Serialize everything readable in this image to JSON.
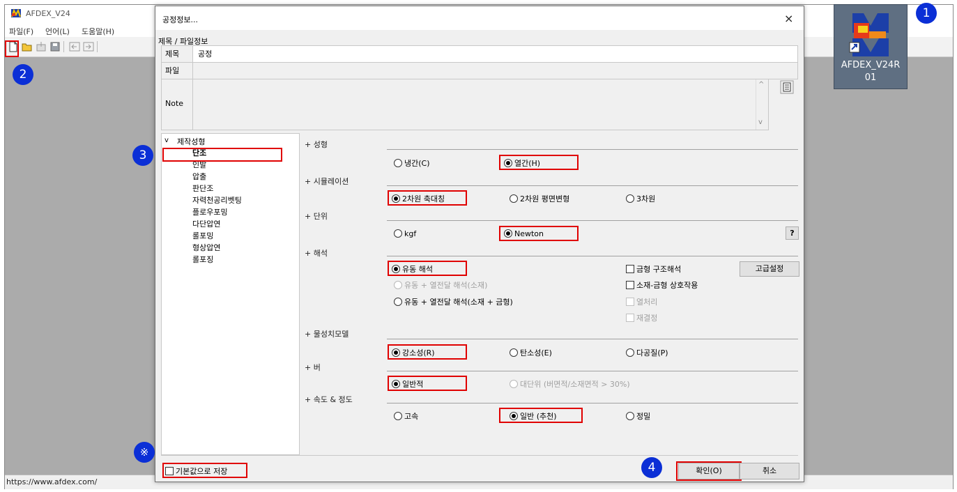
{
  "app": {
    "title": "AFDEX_V24",
    "menu": [
      "파일(F)",
      "언어(L)",
      "도움말(H)"
    ],
    "status_url": "https://www.afdex.com/"
  },
  "shortcut": {
    "label_line1": "AFDEX_V24R",
    "label_line2": "01"
  },
  "dialog": {
    "title": "공정정보...",
    "close": "×",
    "group_title": "제목 / 파일정보",
    "fields": {
      "title_label": "제목",
      "title_value": "공정",
      "file_label": "파일",
      "file_value": "",
      "note_label": "Note",
      "note_value": ""
    },
    "tree": {
      "root": "제작성형",
      "items": [
        "단조",
        "인발",
        "압출",
        "판단조",
        "자력천공리벳팅",
        "플로우포밍",
        "다단압연",
        "롤포밍",
        "형상압연",
        "롤포징"
      ]
    },
    "categories": {
      "forming": "+ 성형",
      "simulation": "+ 시뮬레이션",
      "unit": "+ 단위",
      "analysis": "+ 해석",
      "material_model": "+ 물성치모델",
      "burr": "+ 버",
      "speed": "+ 속도 & 정도"
    },
    "options": {
      "cold": "냉간(C)",
      "hot": "열간(H)",
      "axisym": "2차원 축대칭",
      "plane": "2차원 평면변형",
      "three_d": "3차원",
      "kgf": "kgf",
      "newton": "Newton",
      "help": "?",
      "flow": "유동 해석",
      "flow_heat_mat": "유동 + 열전달 해석(소재)",
      "flow_heat_mat_die": "유동 + 열전달 해석(소재 + 금형)",
      "die_struct": "금형 구조해석",
      "mat_die_interact": "소재-금형 상호작용",
      "heat_treat": "열처리",
      "recryst": "재결정",
      "advanced": "고급설정",
      "rigid_plastic": "강소성(R)",
      "elastoplastic": "탄소성(E)",
      "porous": "다공질(P)",
      "general": "일반적",
      "large": "대단위 (버면적/소재면적 > 30%)",
      "fast": "고속",
      "normal": "일반 (추천)",
      "precise": "정밀"
    },
    "save_default": "기본값으로 저장",
    "ok": "확인(O)",
    "cancel": "취소"
  },
  "badges": {
    "one": "1",
    "two": "2",
    "three": "3",
    "four": "4",
    "note": "※"
  },
  "colors": {
    "highlight": "#e00000",
    "badge": "#0b2fd6"
  }
}
